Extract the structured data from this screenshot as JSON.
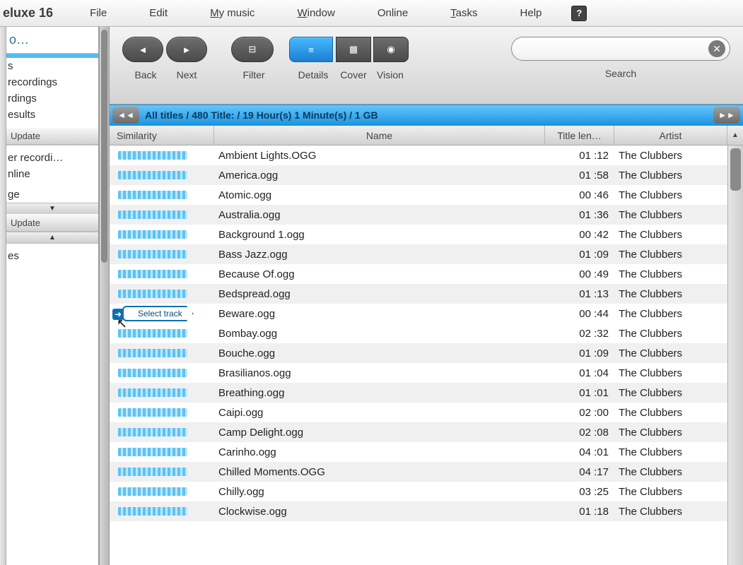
{
  "app_title": "eluxe 16",
  "menu": {
    "file": "File",
    "edit": "Edit",
    "mymusic": "My music",
    "window": "Window",
    "online": "Online",
    "tasks": "Tasks",
    "help": "Help"
  },
  "toolbar": {
    "back": "Back",
    "next": "Next",
    "filter": "Filter",
    "details": "Details",
    "cover": "Cover",
    "vision": "Vision",
    "search": "Search"
  },
  "breadcrumb": "All titles  /  480 Title:  /  19 Hour(s) 1 Minute(s)  /  1 GB",
  "columns": {
    "similarity": "Similarity",
    "name": "Name",
    "length": "Title len…",
    "artist": "Artist"
  },
  "select_track": "Select track",
  "sidebar": {
    "top_dots": "o…",
    "group1": [
      "",
      "s",
      "recordings",
      "rdings",
      "esults",
      ""
    ],
    "update1": "Update",
    "group2": [
      "",
      "er recordi…",
      "nline",
      "",
      "ge"
    ],
    "update2": "Update",
    "group3": [
      "",
      "es"
    ]
  },
  "rows": [
    {
      "name": "Ambient Lights.OGG",
      "len": "01 :12",
      "artist": "The Clubbers"
    },
    {
      "name": "America.ogg",
      "len": "01 :58",
      "artist": "The Clubbers"
    },
    {
      "name": "Atomic.ogg",
      "len": "00 :46",
      "artist": "The Clubbers"
    },
    {
      "name": "Australia.ogg",
      "len": "01 :36",
      "artist": "The Clubbers"
    },
    {
      "name": "Background 1.ogg",
      "len": "00 :42",
      "artist": "The Clubbers"
    },
    {
      "name": "Bass Jazz.ogg",
      "len": "01 :09",
      "artist": "The Clubbers"
    },
    {
      "name": "Because Of.ogg",
      "len": "00 :49",
      "artist": "The Clubbers"
    },
    {
      "name": "Bedspread.ogg",
      "len": "01 :13",
      "artist": "The Clubbers"
    },
    {
      "name": "Beware.ogg",
      "len": "00 :44",
      "artist": "The Clubbers"
    },
    {
      "name": "Bombay.ogg",
      "len": "02 :32",
      "artist": "The Clubbers"
    },
    {
      "name": "Bouche.ogg",
      "len": "01 :09",
      "artist": "The Clubbers"
    },
    {
      "name": "Brasilianos.ogg",
      "len": "01 :04",
      "artist": "The Clubbers"
    },
    {
      "name": "Breathing.ogg",
      "len": "01 :01",
      "artist": "The Clubbers"
    },
    {
      "name": "Caipi.ogg",
      "len": "02 :00",
      "artist": "The Clubbers"
    },
    {
      "name": "Camp Delight.ogg",
      "len": "02 :08",
      "artist": "The Clubbers"
    },
    {
      "name": "Carinho.ogg",
      "len": "04 :01",
      "artist": "The Clubbers"
    },
    {
      "name": "Chilled Moments.OGG",
      "len": "04 :17",
      "artist": "The Clubbers"
    },
    {
      "name": "Chilly.ogg",
      "len": "03 :25",
      "artist": "The Clubbers"
    },
    {
      "name": "Clockwise.ogg",
      "len": "01 :18",
      "artist": "The Clubbers"
    }
  ]
}
